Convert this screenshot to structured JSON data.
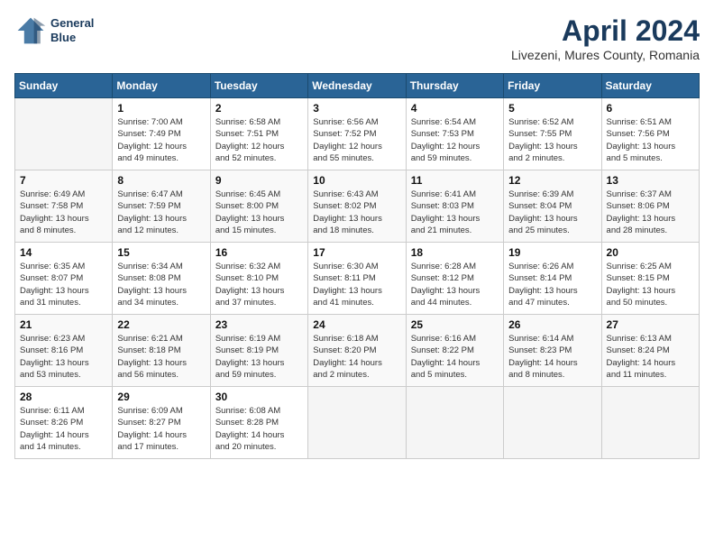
{
  "header": {
    "logo_line1": "General",
    "logo_line2": "Blue",
    "title": "April 2024",
    "subtitle": "Livezeni, Mures County, Romania"
  },
  "weekdays": [
    "Sunday",
    "Monday",
    "Tuesday",
    "Wednesday",
    "Thursday",
    "Friday",
    "Saturday"
  ],
  "weeks": [
    [
      {
        "day": "",
        "info": ""
      },
      {
        "day": "1",
        "info": "Sunrise: 7:00 AM\nSunset: 7:49 PM\nDaylight: 12 hours\nand 49 minutes."
      },
      {
        "day": "2",
        "info": "Sunrise: 6:58 AM\nSunset: 7:51 PM\nDaylight: 12 hours\nand 52 minutes."
      },
      {
        "day": "3",
        "info": "Sunrise: 6:56 AM\nSunset: 7:52 PM\nDaylight: 12 hours\nand 55 minutes."
      },
      {
        "day": "4",
        "info": "Sunrise: 6:54 AM\nSunset: 7:53 PM\nDaylight: 12 hours\nand 59 minutes."
      },
      {
        "day": "5",
        "info": "Sunrise: 6:52 AM\nSunset: 7:55 PM\nDaylight: 13 hours\nand 2 minutes."
      },
      {
        "day": "6",
        "info": "Sunrise: 6:51 AM\nSunset: 7:56 PM\nDaylight: 13 hours\nand 5 minutes."
      }
    ],
    [
      {
        "day": "7",
        "info": "Sunrise: 6:49 AM\nSunset: 7:58 PM\nDaylight: 13 hours\nand 8 minutes."
      },
      {
        "day": "8",
        "info": "Sunrise: 6:47 AM\nSunset: 7:59 PM\nDaylight: 13 hours\nand 12 minutes."
      },
      {
        "day": "9",
        "info": "Sunrise: 6:45 AM\nSunset: 8:00 PM\nDaylight: 13 hours\nand 15 minutes."
      },
      {
        "day": "10",
        "info": "Sunrise: 6:43 AM\nSunset: 8:02 PM\nDaylight: 13 hours\nand 18 minutes."
      },
      {
        "day": "11",
        "info": "Sunrise: 6:41 AM\nSunset: 8:03 PM\nDaylight: 13 hours\nand 21 minutes."
      },
      {
        "day": "12",
        "info": "Sunrise: 6:39 AM\nSunset: 8:04 PM\nDaylight: 13 hours\nand 25 minutes."
      },
      {
        "day": "13",
        "info": "Sunrise: 6:37 AM\nSunset: 8:06 PM\nDaylight: 13 hours\nand 28 minutes."
      }
    ],
    [
      {
        "day": "14",
        "info": "Sunrise: 6:35 AM\nSunset: 8:07 PM\nDaylight: 13 hours\nand 31 minutes."
      },
      {
        "day": "15",
        "info": "Sunrise: 6:34 AM\nSunset: 8:08 PM\nDaylight: 13 hours\nand 34 minutes."
      },
      {
        "day": "16",
        "info": "Sunrise: 6:32 AM\nSunset: 8:10 PM\nDaylight: 13 hours\nand 37 minutes."
      },
      {
        "day": "17",
        "info": "Sunrise: 6:30 AM\nSunset: 8:11 PM\nDaylight: 13 hours\nand 41 minutes."
      },
      {
        "day": "18",
        "info": "Sunrise: 6:28 AM\nSunset: 8:12 PM\nDaylight: 13 hours\nand 44 minutes."
      },
      {
        "day": "19",
        "info": "Sunrise: 6:26 AM\nSunset: 8:14 PM\nDaylight: 13 hours\nand 47 minutes."
      },
      {
        "day": "20",
        "info": "Sunrise: 6:25 AM\nSunset: 8:15 PM\nDaylight: 13 hours\nand 50 minutes."
      }
    ],
    [
      {
        "day": "21",
        "info": "Sunrise: 6:23 AM\nSunset: 8:16 PM\nDaylight: 13 hours\nand 53 minutes."
      },
      {
        "day": "22",
        "info": "Sunrise: 6:21 AM\nSunset: 8:18 PM\nDaylight: 13 hours\nand 56 minutes."
      },
      {
        "day": "23",
        "info": "Sunrise: 6:19 AM\nSunset: 8:19 PM\nDaylight: 13 hours\nand 59 minutes."
      },
      {
        "day": "24",
        "info": "Sunrise: 6:18 AM\nSunset: 8:20 PM\nDaylight: 14 hours\nand 2 minutes."
      },
      {
        "day": "25",
        "info": "Sunrise: 6:16 AM\nSunset: 8:22 PM\nDaylight: 14 hours\nand 5 minutes."
      },
      {
        "day": "26",
        "info": "Sunrise: 6:14 AM\nSunset: 8:23 PM\nDaylight: 14 hours\nand 8 minutes."
      },
      {
        "day": "27",
        "info": "Sunrise: 6:13 AM\nSunset: 8:24 PM\nDaylight: 14 hours\nand 11 minutes."
      }
    ],
    [
      {
        "day": "28",
        "info": "Sunrise: 6:11 AM\nSunset: 8:26 PM\nDaylight: 14 hours\nand 14 minutes."
      },
      {
        "day": "29",
        "info": "Sunrise: 6:09 AM\nSunset: 8:27 PM\nDaylight: 14 hours\nand 17 minutes."
      },
      {
        "day": "30",
        "info": "Sunrise: 6:08 AM\nSunset: 8:28 PM\nDaylight: 14 hours\nand 20 minutes."
      },
      {
        "day": "",
        "info": ""
      },
      {
        "day": "",
        "info": ""
      },
      {
        "day": "",
        "info": ""
      },
      {
        "day": "",
        "info": ""
      }
    ]
  ]
}
